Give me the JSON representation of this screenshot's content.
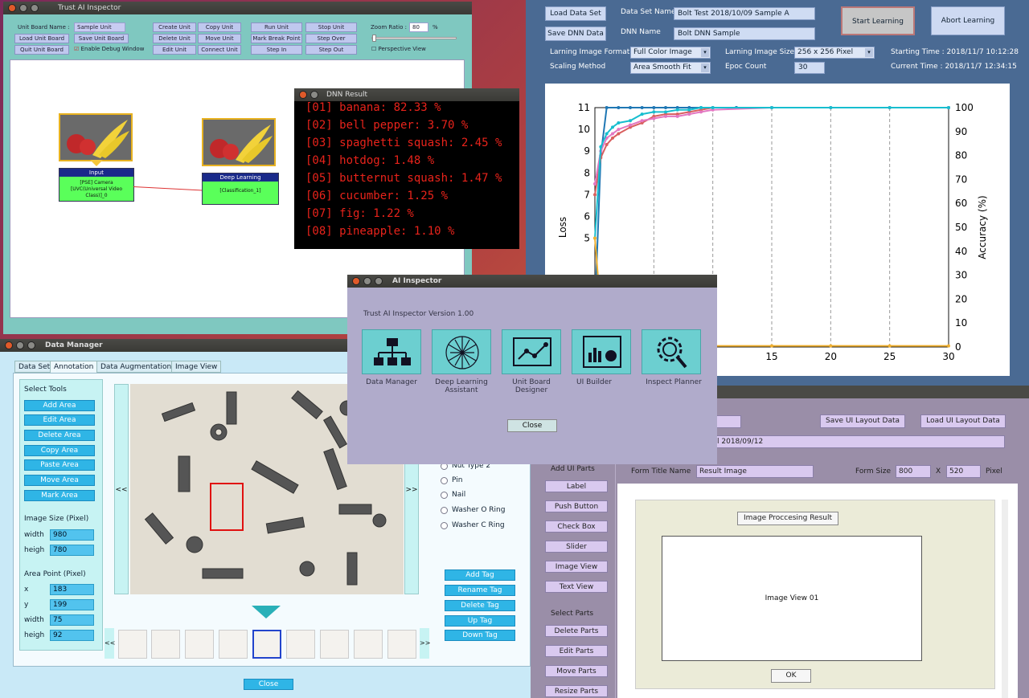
{
  "unit_designer": {
    "title": "Trust AI Inspector",
    "board_label": "Unit Board Name :",
    "board_value": "Sample Unit Board",
    "buttons": {
      "load": "Load Unit Board",
      "save": "Save Unit Board",
      "quit": "Quit Unit Board",
      "debug": "Enable Debug Window",
      "create": "Create Unit",
      "copy": "Copy Unit",
      "delete": "Delete Unit",
      "move": "Move Unit",
      "edit": "Edit Unit",
      "connect": "Connect Unit",
      "run": "Run Unit",
      "stop": "Stop Unit",
      "mark": "Mark Break Point",
      "stepover": "Step Over",
      "stepin": "Step In",
      "stepout": "Step Out"
    },
    "zoom_label": "Zoom Ratio :",
    "zoom_value": "80",
    "zoom_unit": "%",
    "perspective": "Perspective View",
    "input_unit": {
      "title": "Input",
      "body": "[PSE] Camera [UVC(Universal Video Class)]_0"
    },
    "dl_unit": {
      "title": "Deep Learning",
      "body": "[Classification_1]"
    }
  },
  "training": {
    "load_btn": "Load Data Set",
    "save_btn": "Save DNN Data",
    "dataset_label": "Data Set Name",
    "dataset_value": "Bolt Test 2018/10/09 Sample A",
    "dnn_label": "DNN Name",
    "dnn_value": "Bolt DNN Sample",
    "start_btn": "Start Learning",
    "abort_btn": "Abort Learning",
    "format_label": "Larning Image Format",
    "format_value": "Full Color Image",
    "scaling_label": "Scaling Method",
    "scaling_value": "Area Smooth Fit",
    "size_label": "Larning Image Size",
    "size_value": "256 x 256 Pixel",
    "epoc_label": "Epoc Count",
    "epoc_value": "30",
    "start_time": "Starting Time : 2018/11/7 10:12:28",
    "current_time": "Current Time : 2018/11/7 12:34:15"
  },
  "chart_data": {
    "type": "line",
    "xlabel": "",
    "ylabel": "Loss",
    "y2label": "Accuracy (%)",
    "xlim": [
      0,
      30
    ],
    "ylim": [
      0,
      11
    ],
    "y2lim": [
      0,
      100
    ],
    "x_ticks": [
      "15",
      "20",
      "25",
      "30"
    ],
    "y_ticks": [
      "5",
      "6",
      "7",
      "8",
      "9",
      "10",
      "11"
    ],
    "y2_ticks": [
      "0",
      "10",
      "20",
      "30",
      "40",
      "50",
      "60",
      "70",
      "80",
      "90",
      "100"
    ],
    "series": [
      {
        "axis": "y2",
        "color": "#1f77b4",
        "x": [
          0,
          0.5,
          1,
          2,
          3,
          4,
          5,
          6,
          7,
          8,
          9,
          10,
          12,
          15,
          20,
          25,
          30
        ],
        "values": [
          15,
          80,
          100,
          100,
          100,
          100,
          100,
          100,
          100,
          100,
          100,
          100,
          100,
          100,
          100,
          100,
          100
        ]
      },
      {
        "axis": "y",
        "color": "#d95f5f",
        "x": [
          0,
          0.5,
          1,
          1.5,
          2,
          3,
          4,
          5,
          6,
          7,
          8,
          9,
          10,
          15,
          20,
          25,
          30
        ],
        "values": [
          7,
          8.7,
          9.3,
          9.6,
          9.8,
          10.1,
          10.3,
          10.6,
          10.7,
          10.7,
          10.8,
          10.9,
          11,
          11,
          11,
          11,
          11
        ]
      },
      {
        "axis": "y",
        "color": "#e377c2",
        "x": [
          0,
          0.5,
          1,
          1.5,
          2,
          3,
          4,
          5,
          6,
          7,
          8,
          9,
          10,
          15,
          20,
          25,
          30
        ],
        "values": [
          7.5,
          9.0,
          9.6,
          9.8,
          10.0,
          10.2,
          10.4,
          10.5,
          10.6,
          10.6,
          10.7,
          10.8,
          10.9,
          11,
          11,
          11,
          11
        ]
      },
      {
        "axis": "y",
        "color": "#17becf",
        "x": [
          0,
          0.5,
          1,
          1.5,
          2,
          3,
          4,
          5,
          6,
          7,
          8,
          9,
          10,
          15,
          20,
          25,
          30
        ],
        "values": [
          5,
          9.2,
          9.8,
          10.1,
          10.3,
          10.4,
          10.7,
          10.8,
          10.8,
          10.9,
          10.9,
          11,
          11,
          11,
          11,
          11,
          11
        ]
      },
      {
        "axis": "y",
        "color": "#f0b030",
        "x": [
          0,
          0.3,
          0.6,
          1,
          2,
          5,
          10,
          15,
          20,
          25,
          30
        ],
        "values": [
          5,
          3,
          1.5,
          0.6,
          0.2,
          0.05,
          0.05,
          0.05,
          0.05,
          0.05,
          0.05
        ]
      }
    ]
  },
  "dnn_result": {
    "title": "DNN Result",
    "lines": [
      "[01] banana: 82.33 %",
      "[02] bell pepper: 3.70 %",
      "[03] spaghetti squash: 2.45 %",
      "[04] hotdog: 1.48 %",
      "[05] butternut squash: 1.47 %",
      "[06] cucumber: 1.25 %",
      "[07] fig: 1.22 %",
      "[08] pineapple: 1.10 %"
    ]
  },
  "ai_inspector": {
    "title": "AI Inspector",
    "version": "Trust AI Inspector Version 1.00",
    "tools": [
      "Data Manager",
      "Deep Learning Assistant",
      "Unit Board Designer",
      "UI Builder",
      "Inspect Planner"
    ],
    "close": "Close"
  },
  "data_manager": {
    "title": "Data Manager",
    "tabs": [
      "Data Set",
      "Annotation",
      "Data Augmentation",
      "Image View"
    ],
    "select_tools": "Select Tools",
    "tools": [
      "Add Area",
      "Edit Area",
      "Delete Area",
      "Copy Area",
      "Paste Area",
      "Move Area",
      "Mark Area"
    ],
    "image_size_label": "Image Size (Pixel)",
    "width_label": "width",
    "height_label": "heigh",
    "img_w": "980",
    "img_h": "780",
    "area_label": "Area Point (Pixel)",
    "x_label": "x",
    "y_label": "y",
    "area_x": "183",
    "area_y": "199",
    "area_w": "75",
    "area_h": "92",
    "tags": [
      "Nut Type 2",
      "Pin",
      "Nail",
      "Washer O Ring",
      "Washer C Ring"
    ],
    "tag_buttons": [
      "Add Tag",
      "Rename Tag",
      "Delete Tag",
      "Up Tag",
      "Down Tag"
    ],
    "close": "Close",
    "prev": "<<",
    "next": ">>"
  },
  "ui_builder": {
    "save_btn": "Save UI Layout Data",
    "load_btn": "Load UI Layout Data",
    "date_value": "l 2018/09/12",
    "add_parts": "Add UI Parts",
    "parts": [
      "Label",
      "Push Button",
      "Check Box",
      "Slider",
      "Image View",
      "Text View"
    ],
    "select_parts": "Select Parts",
    "select_buttons": [
      "Delete Parts",
      "Edit Parts",
      "Move Parts",
      "Resize Parts"
    ],
    "form_title_label": "Form Title Name",
    "form_title_value": "Result Image",
    "form_size_label": "Form Size",
    "form_w": "800",
    "x_sep": "X",
    "form_h": "520",
    "pixel": "Pixel",
    "preview_title": "Image Proccesing Result",
    "preview_image": "Image View 01",
    "ok": "OK"
  }
}
